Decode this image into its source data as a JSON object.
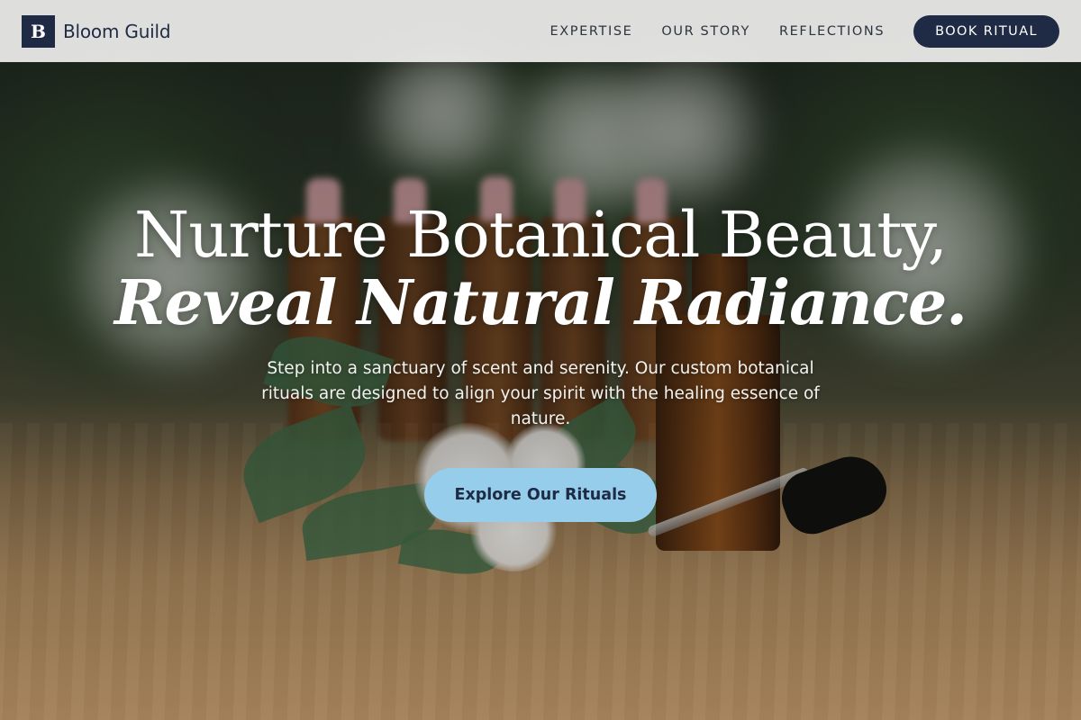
{
  "brand": {
    "logo_letter": "B",
    "name": "Bloom Guild"
  },
  "nav": {
    "links": [
      "EXPERTISE",
      "OUR STORY",
      "REFLECTIONS"
    ],
    "cta_label": "BOOK RITUAL"
  },
  "hero": {
    "headline_line1": "Nurture Botanical Beauty,",
    "headline_line2": "Reveal Natural Radiance.",
    "subtext": "Step into a sanctuary of scent and serenity. Our custom botanical rituals are designed to align your spirit with the healing essence of nature.",
    "cta_label": "Explore Our Rituals"
  },
  "colors": {
    "navy": "#1f2a44",
    "cta_blue": "#95cdea",
    "header_bg": "#eeeeec"
  }
}
